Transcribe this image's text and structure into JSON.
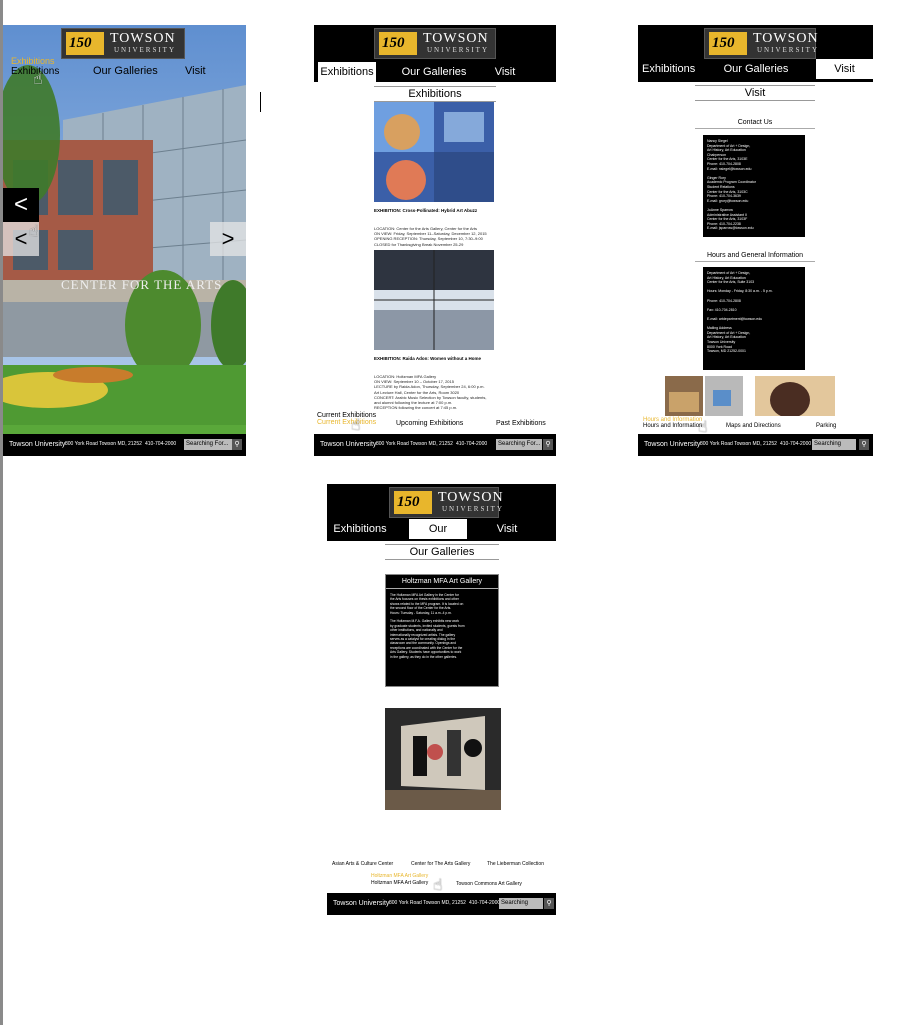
{
  "brand": {
    "badge": "150",
    "name": "TOWSON",
    "sub": "UNIVERSITY"
  },
  "nav": {
    "exhibitions": "Exhibitions",
    "galleries": "Our Galleries",
    "visit": "Visit"
  },
  "footer": {
    "name": "Towson University",
    "address": "800 York Road Towson MD, 21252",
    "phone": "410-704-2000",
    "search_placeholder": "Searching For...",
    "search_icon": "magnifier-icon"
  },
  "home": {
    "hover_label": "Exhibitions",
    "building_sign": "CENTER FOR THE ARTS",
    "prev_glyph": "<",
    "next_glyph": ">"
  },
  "exhibitions_page": {
    "title": "Exhibitions",
    "exhibit1_title": "EXHIBITION: Cross-Pollinated: Hybrid Art Abuzz",
    "exhibit1_details": "LOCATION: Center for the Arts Gallery, Center for the Arts\nON VIEW: Friday, September 11–Saturday, December 12, 2015\nOPENING RECEPTION: Thursday, September 10, 7:30–9:00\nCLOSED for Thanksgiving Break November 25-29",
    "exhibit2_title": "EXHIBITION: Raida Adon: Women without a Home",
    "exhibit2_details": "LOCATION: Holtzman MFA Gallery\nON VIEW: September 10 – October 17, 2015\nLECTURE by Raida Adon, Thursday, September 24, 6:00 p.m.\nArt Lecture Hall, Center for the Arts, Room 3020\nCONCERT: Arabic Music Selection by Towson faculty, students,\nand alumni following the lecture at 7:00 p.m.\nRECEPTION following the concert at 7:45 p.m.",
    "tabs": [
      "Current Exhibitions",
      "Upcoming Exhibitions",
      "Past Exhibitions"
    ],
    "hover_tab": "Current Exhibitions"
  },
  "visit_page": {
    "title": "Visit",
    "contact_heading": "Contact Us",
    "contacts": "Nancy Siegel\nDepartment of Art + Design,\nArt History, Art Education\nChairperson\nCenter for the Arts, 3103E\nPhone: 410-704-2808\nE-mail: nsiegel@towson.edu\n\nGinger Rory\nAcademic Program Coordinator\nStudent Relations\nCenter for the Arts, 3103C\nPhone: 410-704-3639\nE-mail: grory@towson.edu\n\nJoAnne Sparrow\nAdministrative Assistant II\nCenter for the Arts, 3103F\nPhone: 410-704-2238\nE-mail: jsparrow@towson.edu",
    "hours_heading": "Hours and General Information",
    "hours": "Department of Art + Design,\nArt History, Art Education\nCenter for the Arts, Suite 3103\n\nHours: Monday - Friday, 8:30 a.m. - 5 p.m.\n\nPhone: 410-704-2808\n\nFax: 410-704-2810\n\nE-mail: artdepartment@towson.edu\n\nMailing Address\nDepartment of Art + Design,\nArt History, Art Education\nTowson University\n8000 York Road\nTowson, MD 21252-0001",
    "tabs": [
      "Hours and Information",
      "Maps and Directions",
      "Parking"
    ],
    "hover_tab": "Hours and Information"
  },
  "galleries_page": {
    "title": "Our Galleries",
    "gallery_heading": "Holtzman MFA Art Gallery",
    "gallery_text": "The Holtzman MFA Art Gallery in the Center for\nthe Arts focuses on thesis exhibitions and other\nshows related to the MFA program. It is located on\nthe second floor of the Center for the Arts.\nHours: Tuesday - Saturday, 11 a.m.-4 p.m.\n\nThe Holtzman M.F.A. Gallery exhibits new work\nby graduate students, invited students, guests from\nother institutions, and nationally and\ninternationally recognized artists. The gallery\nserves as a catalyst for creating dialog in the\nclassroom and the community. Openings and\nreceptions are coordinated with the Center for the\nArts Gallery. Students have opportunities to work\nin the gallery, as they do in the other galleries.",
    "links_row1": [
      "Asian Arts  & Culture Center",
      "Center for The Arts Gallery",
      "The Lieberman Collection"
    ],
    "hover_link": "Holtzman MFA Art Gallery",
    "links_row2": [
      "Holtzman MFA Art Gallery",
      "Towson Commons Art Gallery"
    ]
  }
}
